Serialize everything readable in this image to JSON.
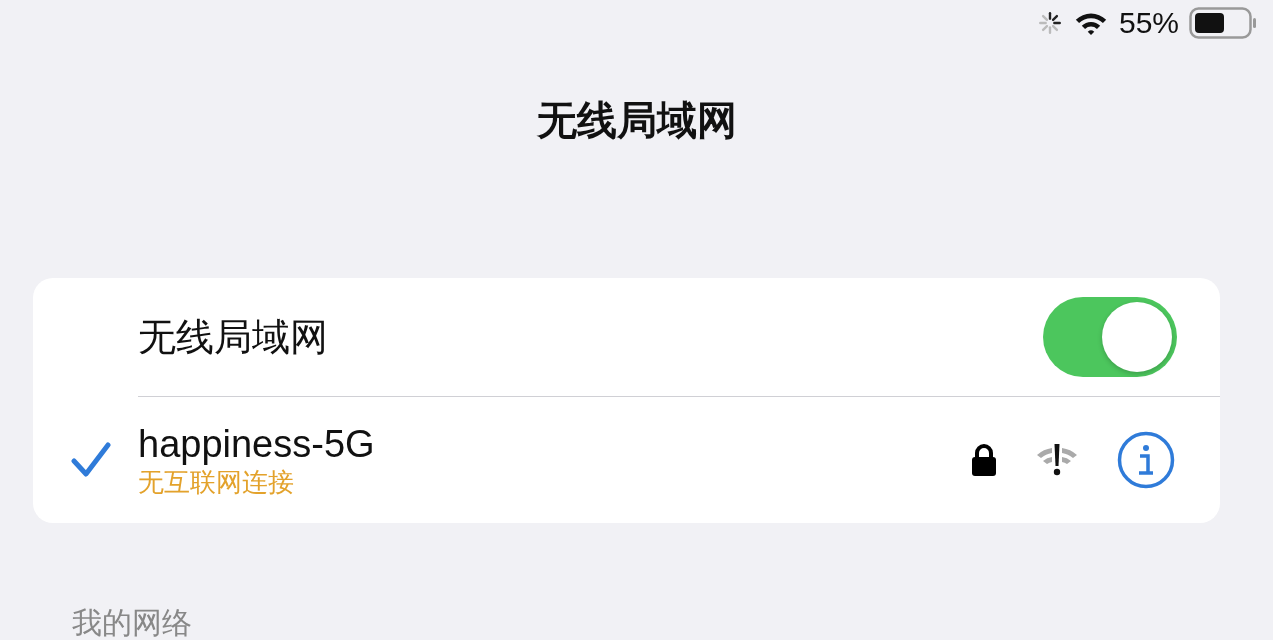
{
  "status_bar": {
    "battery": "55%"
  },
  "title": "无线局域网",
  "wifi": {
    "label": "无线局域网",
    "on": true
  },
  "networks": [
    {
      "name": "happiness-5G",
      "status": "无互联网连接",
      "selected": true,
      "secured": true
    }
  ],
  "section_header": "我的网络"
}
